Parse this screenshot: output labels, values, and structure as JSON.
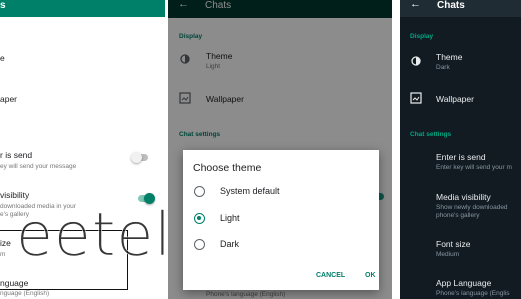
{
  "colors": {
    "primary": "#008069",
    "dark_appbar": "#1f2c34",
    "dark_bg": "#121b22",
    "accent_dark": "#00a884"
  },
  "left_panel": {
    "appbar_title": "s",
    "display_theme_value": "e",
    "wallpaper_label": "aper",
    "enter_is_send": {
      "title": "r is send",
      "subtitle": "ey will send your message",
      "enabled": false
    },
    "media_visibility": {
      "title": "visibility",
      "subtitle_line1": "downloaded media in your",
      "subtitle_line2": "e's gallery",
      "enabled": true
    },
    "font_size": {
      "title": "ize",
      "subtitle": "m"
    },
    "app_language": {
      "title": "nguage",
      "subtitle": "nguage (English)"
    },
    "watermark": "eetel"
  },
  "middle_panel": {
    "appbar_title": "Chats",
    "display_header": "Display",
    "theme": {
      "title": "Theme",
      "subtitle": "Light"
    },
    "wallpaper_label": "Wallpaper",
    "chat_settings_header": "Chat settings",
    "bottom_peek": "Phone's language (English)",
    "dialog": {
      "title": "Choose theme",
      "options": [
        "System default",
        "Light",
        "Dark"
      ],
      "selected": "Light",
      "cancel_label": "CANCEL",
      "ok_label": "OK"
    }
  },
  "right_panel": {
    "appbar_title": "Chats",
    "display_header": "Display",
    "theme": {
      "title": "Theme",
      "subtitle": "Dark"
    },
    "wallpaper_label": "Wallpaper",
    "chat_settings_header": "Chat settings",
    "enter_is_send": {
      "title": "Enter is send",
      "subtitle": "Enter key will send your m"
    },
    "media_visibility": {
      "title": "Media visibility",
      "subtitle_line1": "Show newly downloaded",
      "subtitle_line2": "phone's gallery"
    },
    "font_size": {
      "title": "Font size",
      "subtitle": "Medium"
    },
    "app_language": {
      "title": "App Language",
      "subtitle": "Phone's language (Englis"
    }
  }
}
